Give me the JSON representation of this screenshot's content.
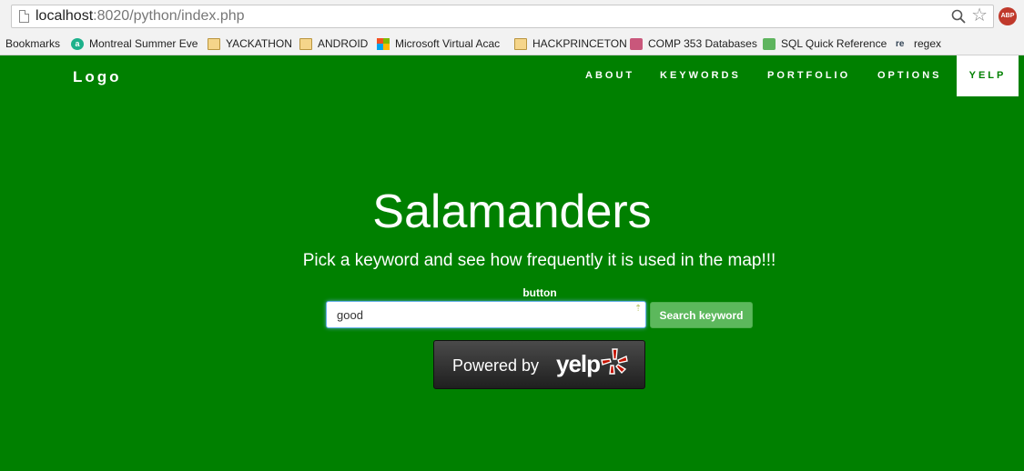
{
  "browser": {
    "url_host": "localhost",
    "url_path": ":8020/python/index.php",
    "bookmarks": [
      {
        "label": "Bookmarks",
        "icon": "none"
      },
      {
        "label": "Montreal Summer Eve",
        "icon": "circle-a-icon"
      },
      {
        "label": "YACKATHON",
        "icon": "folder-icon"
      },
      {
        "label": "ANDROID",
        "icon": "folder-icon"
      },
      {
        "label": "Microsoft Virtual Acac",
        "icon": "microsoft-icon"
      },
      {
        "label": "HACKPRINCETON",
        "icon": "folder-icon"
      },
      {
        "label": "COMP 353 Databases",
        "icon": "bookmark-icon"
      },
      {
        "label": "SQL Quick Reference",
        "icon": "sql-icon"
      },
      {
        "label": "regex",
        "icon": "re-icon"
      }
    ],
    "abp_label": "ABP"
  },
  "nav": {
    "logo": "Logo",
    "links": [
      "ABOUT",
      "KEYWORDS",
      "PORTFOLIO",
      "OPTIONS",
      "YELP"
    ],
    "active": "YELP"
  },
  "hero": {
    "title": "Salamanders",
    "subtitle": "Pick a keyword and see how frequently it is used in the map!!!",
    "button_label": "button",
    "search_value": "good",
    "search_button": "Search keyword",
    "badge": {
      "powered": "Powered by",
      "brand": "yelp"
    }
  },
  "colors": {
    "background": "#008000",
    "accent_button": "#5cb85c",
    "yelp_red": "#c41200"
  }
}
